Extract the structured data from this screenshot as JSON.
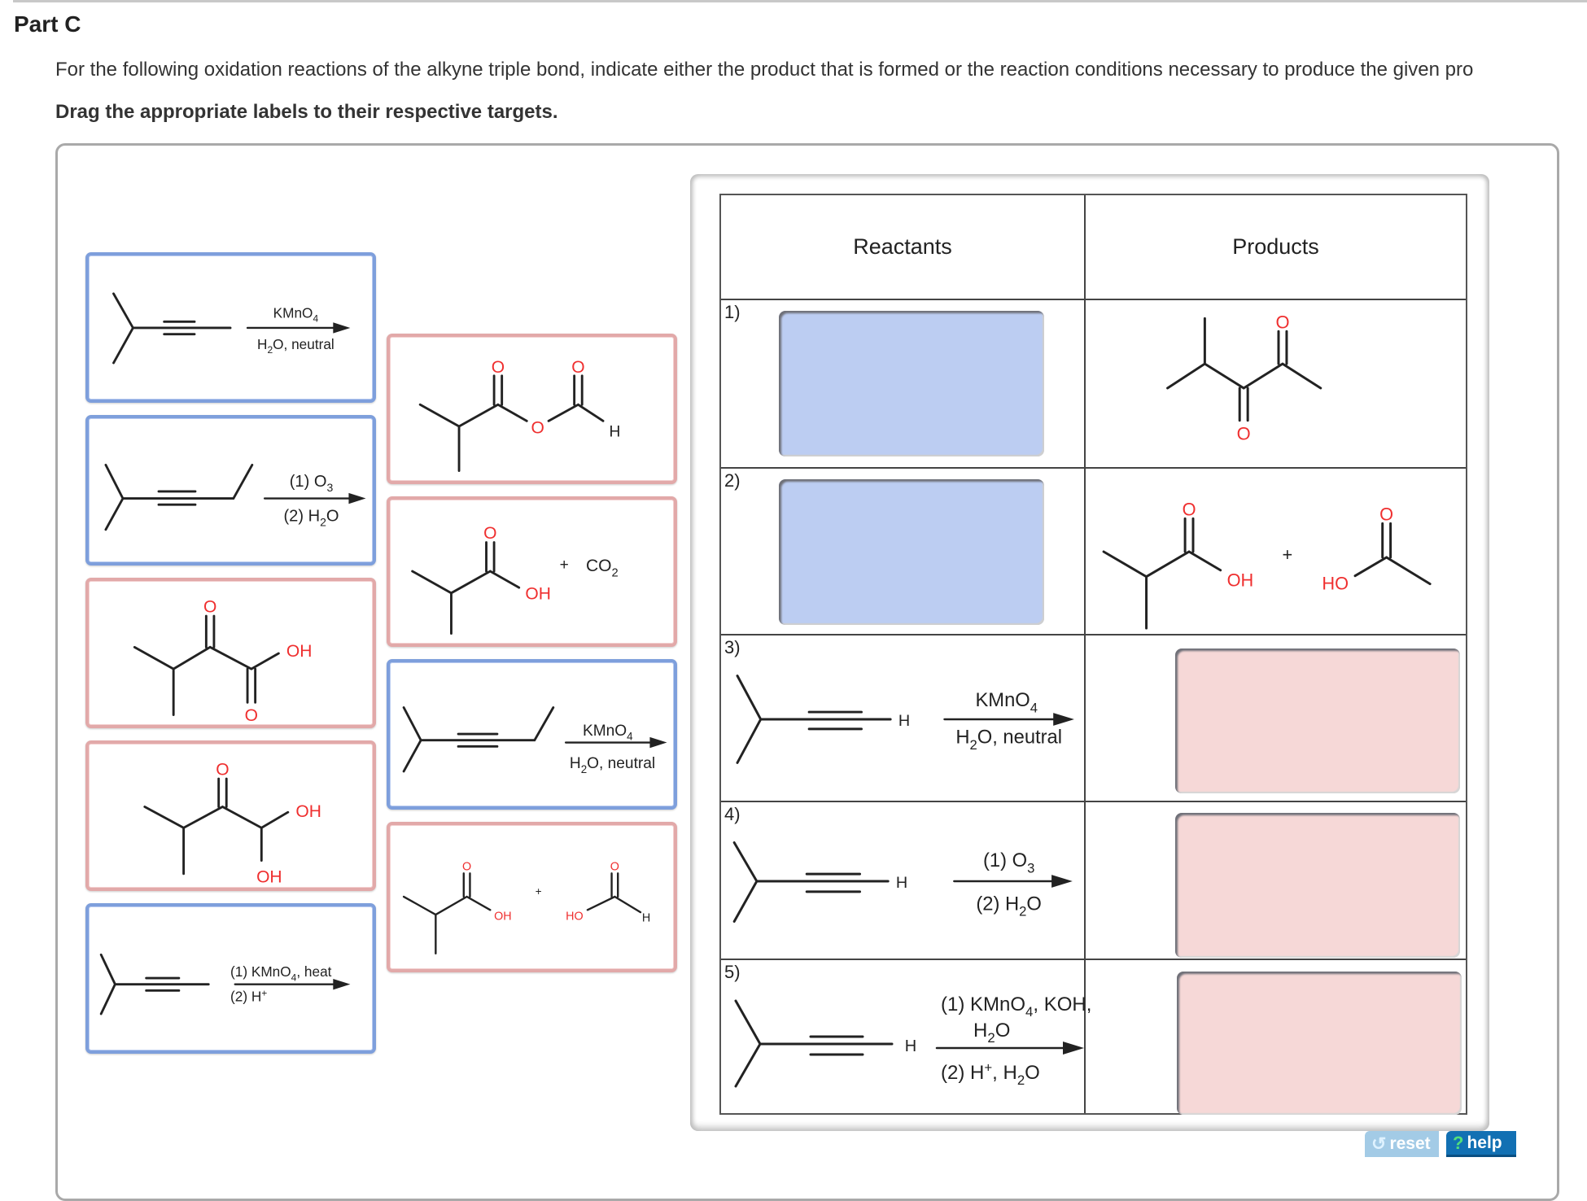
{
  "header": {
    "part_title": "Part C",
    "instruction": "For the following oxidation reactions of the alkyne triple bond, indicate either the product that is formed or the reaction conditions necessary to produce the given pro",
    "instruction_bold": "Drag the appropriate labels to their respective targets."
  },
  "labels": [
    {
      "id": "L1",
      "kind": "reactant-conditions",
      "structure": "4-methyl-2-pentyne",
      "reagent_top": "KMnO4",
      "reagent_top_sub": "",
      "reagent_bottom": "H2O, neutral"
    },
    {
      "id": "L2",
      "kind": "reactant-conditions",
      "structure": "2-methyl-3-hexyne",
      "reagent_top": "(1) O3",
      "reagent_bottom": "(2) H2O"
    },
    {
      "id": "L3",
      "kind": "product",
      "structure": "3-methyl-2-oxobutanoic acid",
      "atoms": [
        "O",
        "OH",
        "O"
      ]
    },
    {
      "id": "L4",
      "kind": "product",
      "structure": "1,1-dihydroxy-3-methyl-2-butanone",
      "atoms": [
        "O",
        "OH",
        "OH"
      ]
    },
    {
      "id": "L5",
      "kind": "reactant-conditions",
      "structure": "4-methyl-2-pentyne",
      "reagent_top": "(1) KMnO4, heat",
      "reagent_bottom": "(2) H+"
    },
    {
      "id": "L6",
      "kind": "product",
      "structure": "isobutyric formic anhydride",
      "atoms": [
        "O",
        "O",
        "O",
        "H"
      ]
    },
    {
      "id": "L7",
      "kind": "product",
      "structure": "isobutyric acid + CO2",
      "atoms": [
        "O",
        "OH"
      ],
      "plus": "+",
      "extra": "CO2"
    },
    {
      "id": "L8",
      "kind": "reactant-conditions",
      "structure": "2-methyl-3-hexyne",
      "reagent_top": "KMnO4",
      "reagent_bottom": "H2O, neutral"
    },
    {
      "id": "L9",
      "kind": "product",
      "structure": "isobutyric acid + formic acid",
      "atoms": [
        "O",
        "OH",
        "O",
        "HO",
        "H"
      ],
      "plus": "+"
    }
  ],
  "table": {
    "headers": [
      "Reactants",
      "Products"
    ],
    "rows": [
      {
        "num": "1)",
        "reactant": {
          "type": "drop-target",
          "state": "empty"
        },
        "product": {
          "type": "structure",
          "name": "3-methyl-2,3-pentanedione... (4-methyl-2,3-pentanedione)",
          "atoms": [
            "O",
            "O"
          ]
        }
      },
      {
        "num": "2)",
        "reactant": {
          "type": "drop-target",
          "state": "empty"
        },
        "product": {
          "type": "structure",
          "name": "isobutyric acid + acetic acid",
          "atoms": [
            "O",
            "OH",
            "O",
            "HO"
          ],
          "plus": "+"
        }
      },
      {
        "num": "3)",
        "reactant": {
          "type": "structure",
          "name": "3-methyl-1-butyne",
          "H": "H",
          "reagent_top": "KMnO4",
          "reagent_bottom": "H2O, neutral"
        },
        "product": {
          "type": "drop-target",
          "state": "empty"
        }
      },
      {
        "num": "4)",
        "reactant": {
          "type": "structure",
          "name": "3-methyl-1-butyne",
          "H": "H",
          "reagent_top": "(1) O3",
          "reagent_bottom": "(2) H2O"
        },
        "product": {
          "type": "drop-target",
          "state": "empty"
        }
      },
      {
        "num": "5)",
        "reactant": {
          "type": "structure",
          "name": "3-methyl-1-butyne",
          "H": "H",
          "reagent_top": "(1) KMnO4, KOH,",
          "reagent_top2": "H2O",
          "reagent_bottom": "(2) H+, H2O"
        },
        "product": {
          "type": "drop-target",
          "state": "empty"
        }
      }
    ]
  },
  "buttons": {
    "reset": {
      "label": "reset",
      "icon": "reset-icon"
    },
    "help": {
      "label": "help",
      "icon": "help-icon"
    }
  },
  "colors": {
    "label_reactant_border": "#7e9fdc",
    "label_product_border": "#e2a9a9",
    "drop_reactant": "#bccdf2",
    "drop_product": "#f6d8d7",
    "oxygen": "#ef2f2f",
    "reset_bg": "#a3cbe6",
    "help_bg": "#1270b3"
  }
}
